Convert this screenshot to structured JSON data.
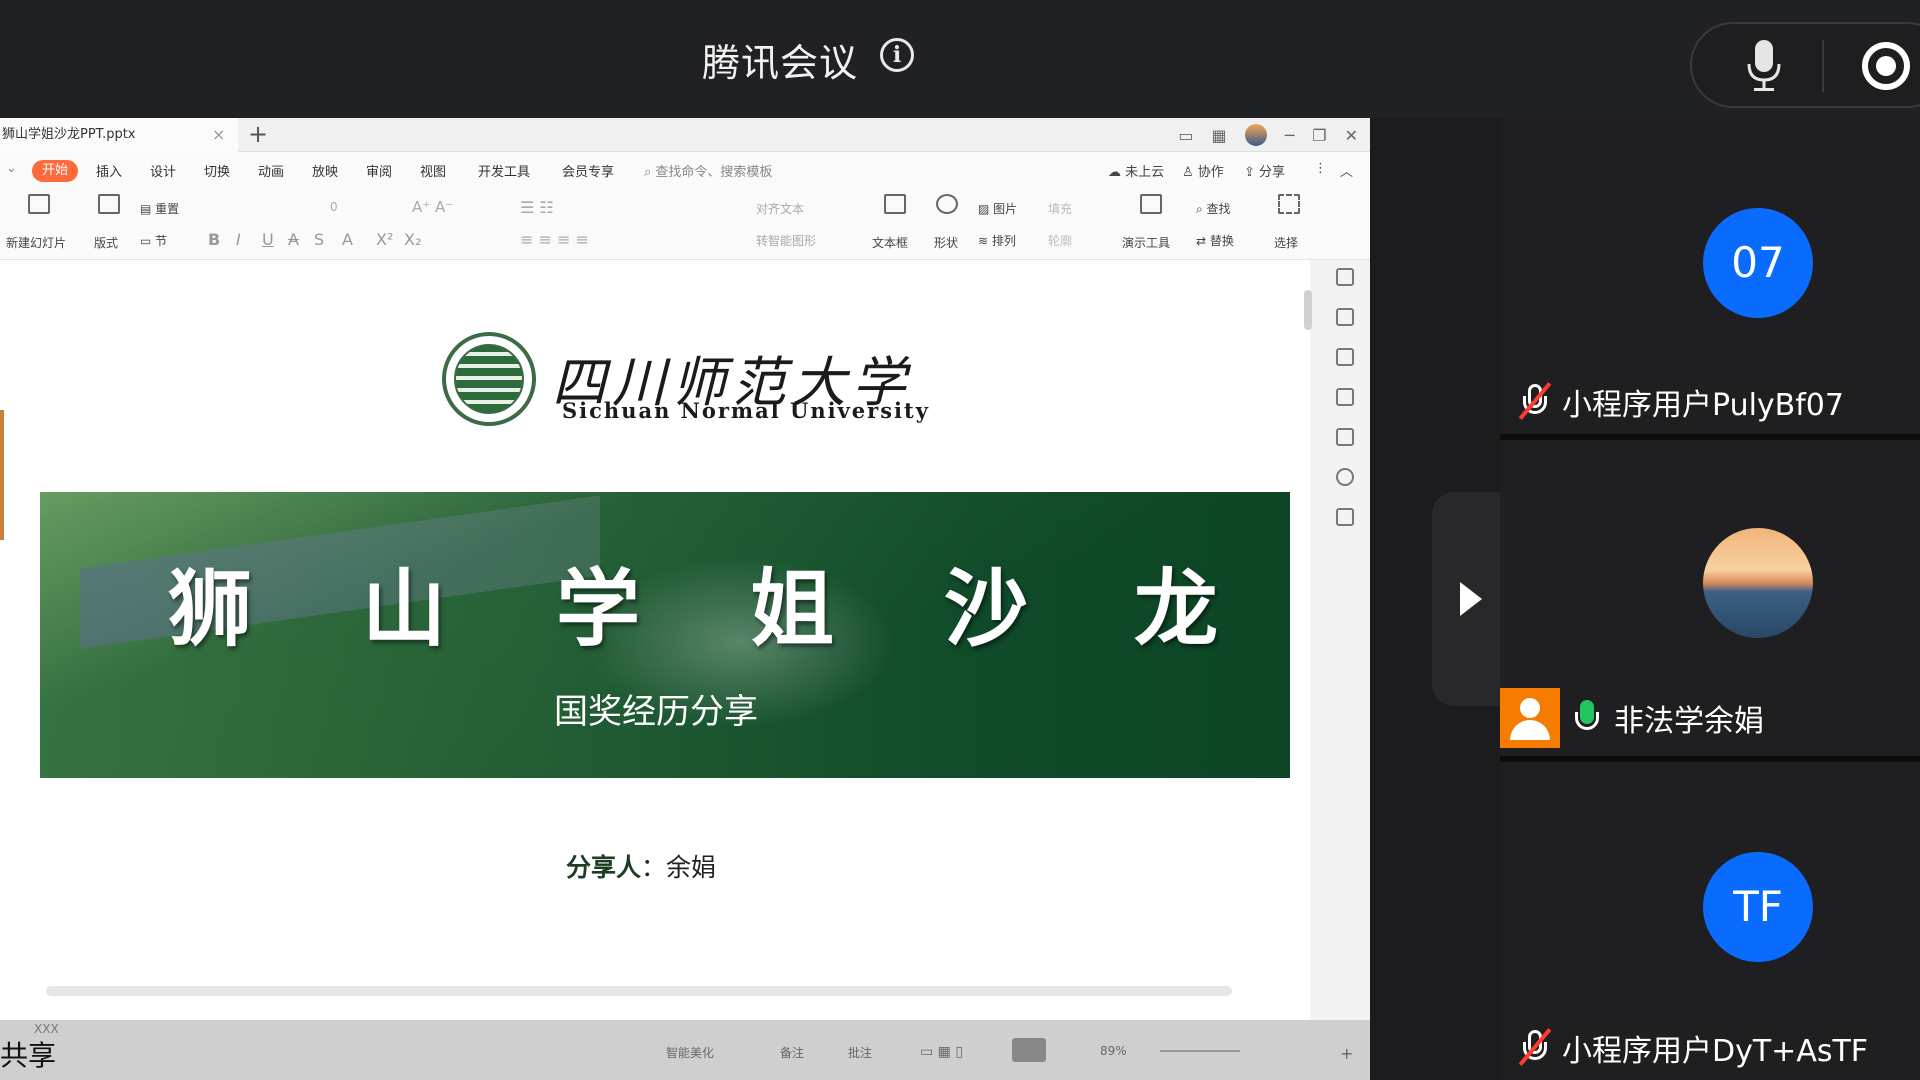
{
  "meeting": {
    "title": "腾讯会议",
    "info_icon": "info-icon"
  },
  "controls": {
    "mic_icon": "microphone-icon",
    "record_icon": "record-icon"
  },
  "wps": {
    "file_name": "狮山学姐沙龙PPT.pptx",
    "tab_add": "+",
    "menu": {
      "active": "开始",
      "items": [
        "插入",
        "设计",
        "切换",
        "动画",
        "放映",
        "审阅",
        "视图",
        "开发工具",
        "会员专享"
      ],
      "search": "查找命令、搜索模板",
      "right": [
        "未上云",
        "协作",
        "分享"
      ]
    },
    "ribbon": {
      "new_slide": "新建幻灯片",
      "layout": "版式",
      "reset": "重置",
      "section": "节",
      "font_size": "0",
      "align_text": "对齐文本",
      "smart_shape": "转智能图形",
      "textbox": "文本框",
      "shape": "形状",
      "picture": "图片",
      "arrange": "排列",
      "fill": "填充",
      "outline": "轮廓",
      "present_tools": "演示工具",
      "find": "查找",
      "replace": "替换",
      "select": "选择"
    },
    "status": {
      "share_label": "共享",
      "xxx": "XXX",
      "beautify": "智能美化",
      "notes": "备注",
      "comments": "批注",
      "zoom": "89%"
    }
  },
  "slide": {
    "logo_cn": "四川师范大学",
    "logo_en": "Sichuan Normal University",
    "title_chars": [
      "狮",
      "山",
      "学",
      "姐",
      "沙",
      "龙"
    ],
    "subtitle": "国奖经历分享",
    "speaker_label": "分享人",
    "speaker_sep": "：",
    "speaker_name": "余娟"
  },
  "participants": [
    {
      "avatar_text": "07",
      "name": "小程序用户PulyBf07",
      "mic": "muted",
      "avatar_color": "#0a6cff"
    },
    {
      "avatar_text": "",
      "name": "非法学余娟",
      "mic": "on",
      "avatar_type": "photo"
    },
    {
      "avatar_text": "TF",
      "name": "小程序用户DyT+AsTF",
      "mic": "muted",
      "avatar_color": "#0a6cff"
    }
  ]
}
